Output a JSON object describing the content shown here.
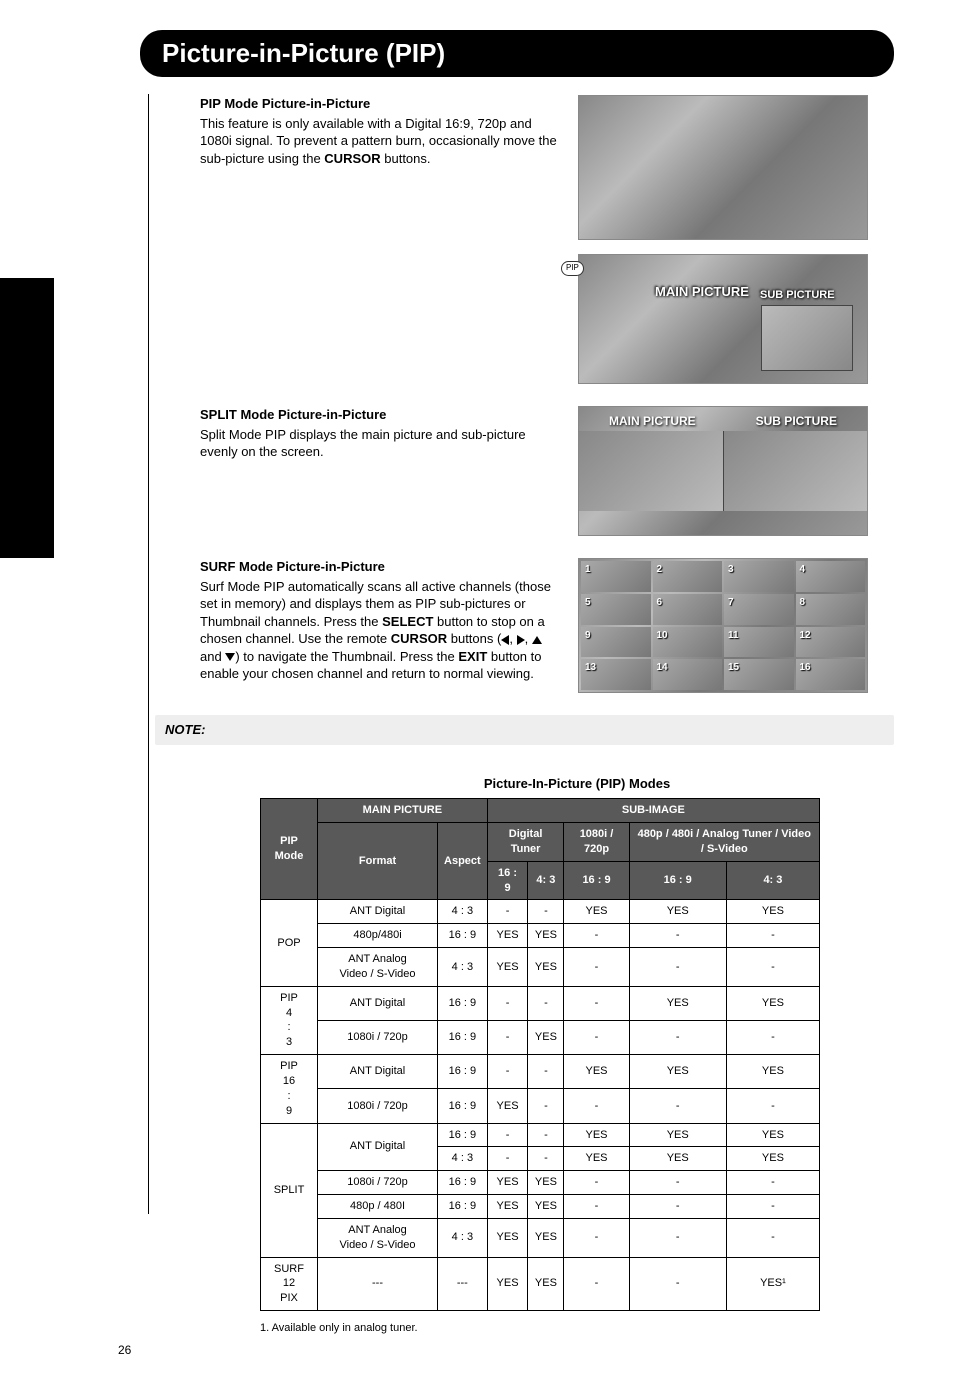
{
  "page_title": "Picture-in-Picture (PIP)",
  "page_number": "26",
  "note_label": "NOTE:",
  "sections": {
    "pip": {
      "heading": "PIP Mode Picture-in-Picture",
      "text_before": "This feature is only available with a Digital 16:9, 720p and 1080i signal. To prevent a pattern burn, occasionally move the sub-picture using the ",
      "bold": "CURSOR",
      "text_after": " buttons.",
      "pip_tag": "PIP",
      "main_label": "MAIN PICTURE",
      "sub_label": "SUB PICTURE"
    },
    "split": {
      "heading": "SPLIT Mode Picture-in-Picture",
      "text": "Split Mode PIP displays the main picture and sub-picture evenly on the screen.",
      "main_label": "MAIN PICTURE",
      "sub_label": "SUB PICTURE"
    },
    "surf": {
      "heading": "SURF Mode Picture-in-Picture",
      "p1a": "Surf Mode PIP automatically scans all active channels (those set in memory) and displays them as PIP sub-pictures or Thumbnail channels. Press the ",
      "p1b": "SELECT",
      "p1c": " button to stop on a chosen channel. Use the remote ",
      "p1d": "CURSOR",
      "p1e": " buttons (",
      "p1f": ") to navigate the Thumbnail. Press the ",
      "p1g": "EXIT",
      "p1h": " button to enable your chosen channel and return to normal viewing.",
      "and": " and ",
      "comma": ", ",
      "cells": [
        "1",
        "2",
        "3",
        "4",
        "5",
        "6",
        "7",
        "8",
        "9",
        "10",
        "11",
        "12",
        "13",
        "14",
        "15",
        "16"
      ]
    }
  },
  "table": {
    "title": "Picture-In-Picture (PIP) Modes",
    "headers": {
      "main_picture": "MAIN PICTURE",
      "sub_image": "SUB-IMAGE",
      "pip_mode": "PIP Mode",
      "format": "Format",
      "aspect": "Aspect",
      "digital_tuner": "Digital Tuner",
      "col_1080_720": "1080i / 720p",
      "col_analog": "480p / 480i / Analog Tuner / Video / S-Video",
      "r169": "16 : 9",
      "r43": "4: 3"
    },
    "rows": [
      {
        "mode": "POP",
        "mode_rows": 3,
        "format": "ANT Digital",
        "aspect": "4 : 3",
        "cells": [
          "-",
          "-",
          "YES",
          "YES",
          "YES"
        ]
      },
      {
        "format": "480p/480i",
        "aspect": "16 : 9",
        "cells": [
          "YES",
          "YES",
          "-",
          "-",
          "-"
        ]
      },
      {
        "format": "ANT Analog Video / S-Video",
        "aspect": "4 : 3",
        "cells": [
          "YES",
          "YES",
          "-",
          "-",
          "-"
        ]
      },
      {
        "mode": "PIP 4 : 3",
        "mode_rows": 2,
        "format": "ANT Digital",
        "aspect": "16 : 9",
        "cells": [
          "-",
          "-",
          "-",
          "YES",
          "YES"
        ]
      },
      {
        "format": "1080i / 720p",
        "aspect": "16 : 9",
        "cells": [
          "-",
          "YES",
          "-",
          "-",
          "-"
        ]
      },
      {
        "mode": "PIP 16 : 9",
        "mode_rows": 2,
        "format": "ANT Digital",
        "aspect": "16 : 9",
        "cells": [
          "-",
          "-",
          "YES",
          "YES",
          "YES"
        ]
      },
      {
        "format": "1080i / 720p",
        "aspect": "16 : 9",
        "cells": [
          "YES",
          "-",
          "-",
          "-",
          "-"
        ]
      },
      {
        "mode": "SPLIT",
        "mode_rows": 5,
        "format": "ANT Digital",
        "format_rows": 2,
        "aspect": "16 : 9",
        "cells": [
          "-",
          "-",
          "YES",
          "YES",
          "YES"
        ]
      },
      {
        "aspect": "4 : 3",
        "cells": [
          "-",
          "-",
          "YES",
          "YES",
          "YES"
        ]
      },
      {
        "format": "1080i / 720p",
        "aspect": "16 : 9",
        "cells": [
          "YES",
          "YES",
          "-",
          "-",
          "-"
        ]
      },
      {
        "format": "480p / 480I",
        "aspect": "16 : 9",
        "cells": [
          "YES",
          "YES",
          "-",
          "-",
          "-"
        ]
      },
      {
        "format": "ANT Analog Video / S-Video",
        "aspect": "4 : 3",
        "cells": [
          "YES",
          "YES",
          "-",
          "-",
          "-"
        ]
      },
      {
        "mode": "SURF 12 PIX",
        "mode_rows": 1,
        "format": "---",
        "aspect": "---",
        "cells": [
          "YES",
          "YES",
          "-",
          "-",
          "YES¹"
        ]
      }
    ],
    "footnote": "1. Available only in analog tuner."
  }
}
